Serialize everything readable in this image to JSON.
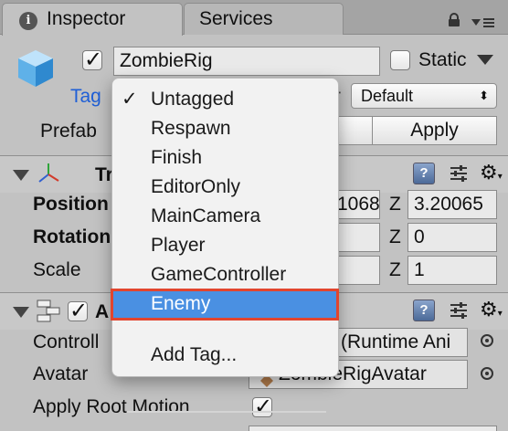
{
  "tabs": [
    {
      "label": "Inspector",
      "active": true
    },
    {
      "label": "Services",
      "active": false
    }
  ],
  "object": {
    "active_checked": true,
    "name": "ZombieRig",
    "static_label": "Static",
    "static_checked": false,
    "tag_label": "Tag",
    "layer_value": "Default",
    "prefab_label": "Prefab",
    "apply_label": "Apply"
  },
  "transform": {
    "header_label": "Tr",
    "rows": [
      {
        "label": "Position",
        "bold": true,
        "x_partial": "1068",
        "z_label": "Z",
        "z_value": "3.20065"
      },
      {
        "label": "Rotation",
        "bold": true,
        "x_partial": "",
        "z_label": "Z",
        "z_value": "0"
      },
      {
        "label": "Scale",
        "bold": false,
        "x_partial": "",
        "z_label": "Z",
        "z_value": "1"
      }
    ]
  },
  "animator": {
    "header_label": "A",
    "enabled": true,
    "controller_label": "Controll",
    "controller_value": "(Runtime Ani",
    "avatar_label": "Avatar",
    "avatar_value": "ZombieRigAvatar",
    "apply_root_motion_label": "Apply Root Motion",
    "apply_root_motion_checked": true
  },
  "tag_menu": {
    "items": [
      {
        "label": "Untagged",
        "checked": true
      },
      {
        "label": "Respawn"
      },
      {
        "label": "Finish"
      },
      {
        "label": "EditorOnly"
      },
      {
        "label": "MainCamera"
      },
      {
        "label": "Player"
      },
      {
        "label": "GameController"
      },
      {
        "label": "Enemy",
        "highlighted": true
      }
    ],
    "add_tag_label": "Add Tag...",
    "highlight_color": "#4a90e2",
    "callout_color": "#e2452e"
  }
}
